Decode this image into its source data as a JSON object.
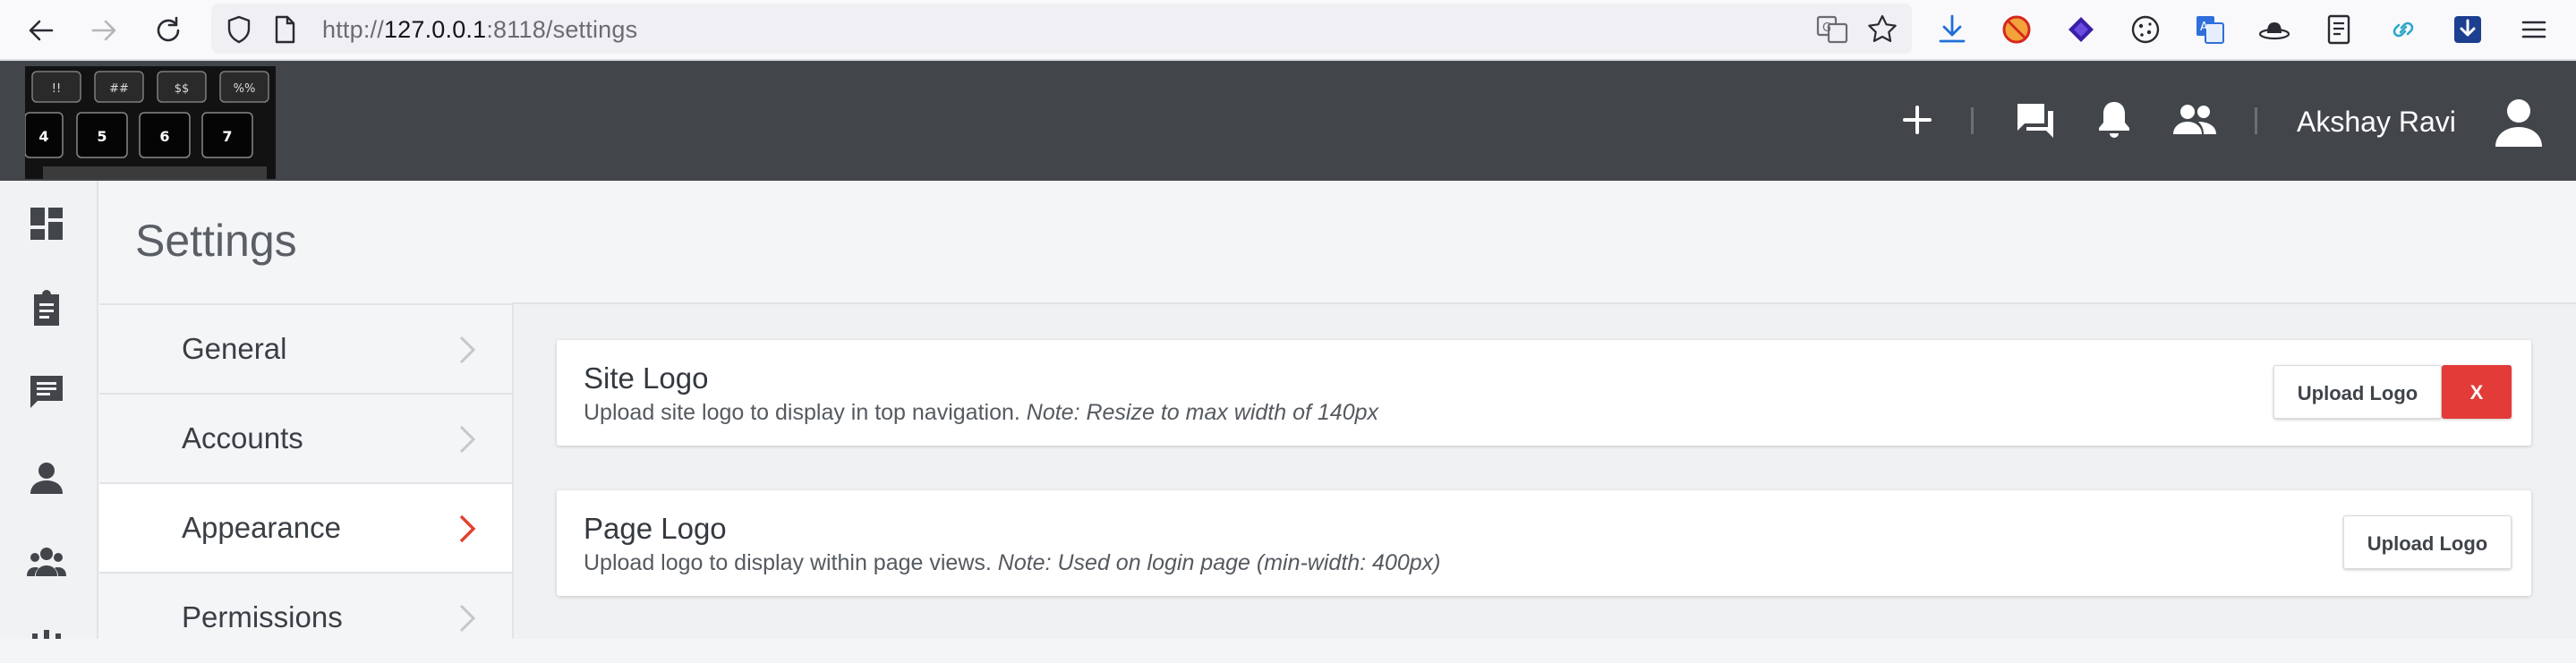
{
  "browser": {
    "url_prefix": "http://",
    "url_host": "127.0.0.1",
    "url_rest": ":8118/settings"
  },
  "header": {
    "user_name": "Akshay Ravi",
    "logo_keys": [
      "!!",
      "##",
      "$$",
      "%%",
      "4",
      "5",
      "6",
      "7"
    ]
  },
  "page": {
    "title": "Settings"
  },
  "settings_nav": [
    {
      "label": "General"
    },
    {
      "label": "Accounts"
    },
    {
      "label": "Appearance"
    },
    {
      "label": "Permissions"
    }
  ],
  "cards": {
    "site_logo": {
      "title": "Site Logo",
      "desc": "Upload site logo to display in top navigation. ",
      "note": "Note: Resize to max width of 140px",
      "upload_label": "Upload Logo",
      "remove_label": "X"
    },
    "page_logo": {
      "title": "Page Logo",
      "desc": "Upload logo to display within page views. ",
      "note": "Note: Used on login page (min-width: 400px)",
      "upload_label": "Upload Logo"
    }
  },
  "colors": {
    "header_bg": "#42464b",
    "accent_active": "#e2402f",
    "remove_button": "#e33b38",
    "page_bg": "#f4f5f7"
  },
  "icons": {
    "rail": [
      "dashboard-icon",
      "clipboard-icon",
      "chat-icon",
      "person-icon",
      "group-icon"
    ],
    "header": [
      "plus-icon",
      "forum-icon",
      "bell-icon",
      "people-icon",
      "user-avatar-icon"
    ]
  }
}
